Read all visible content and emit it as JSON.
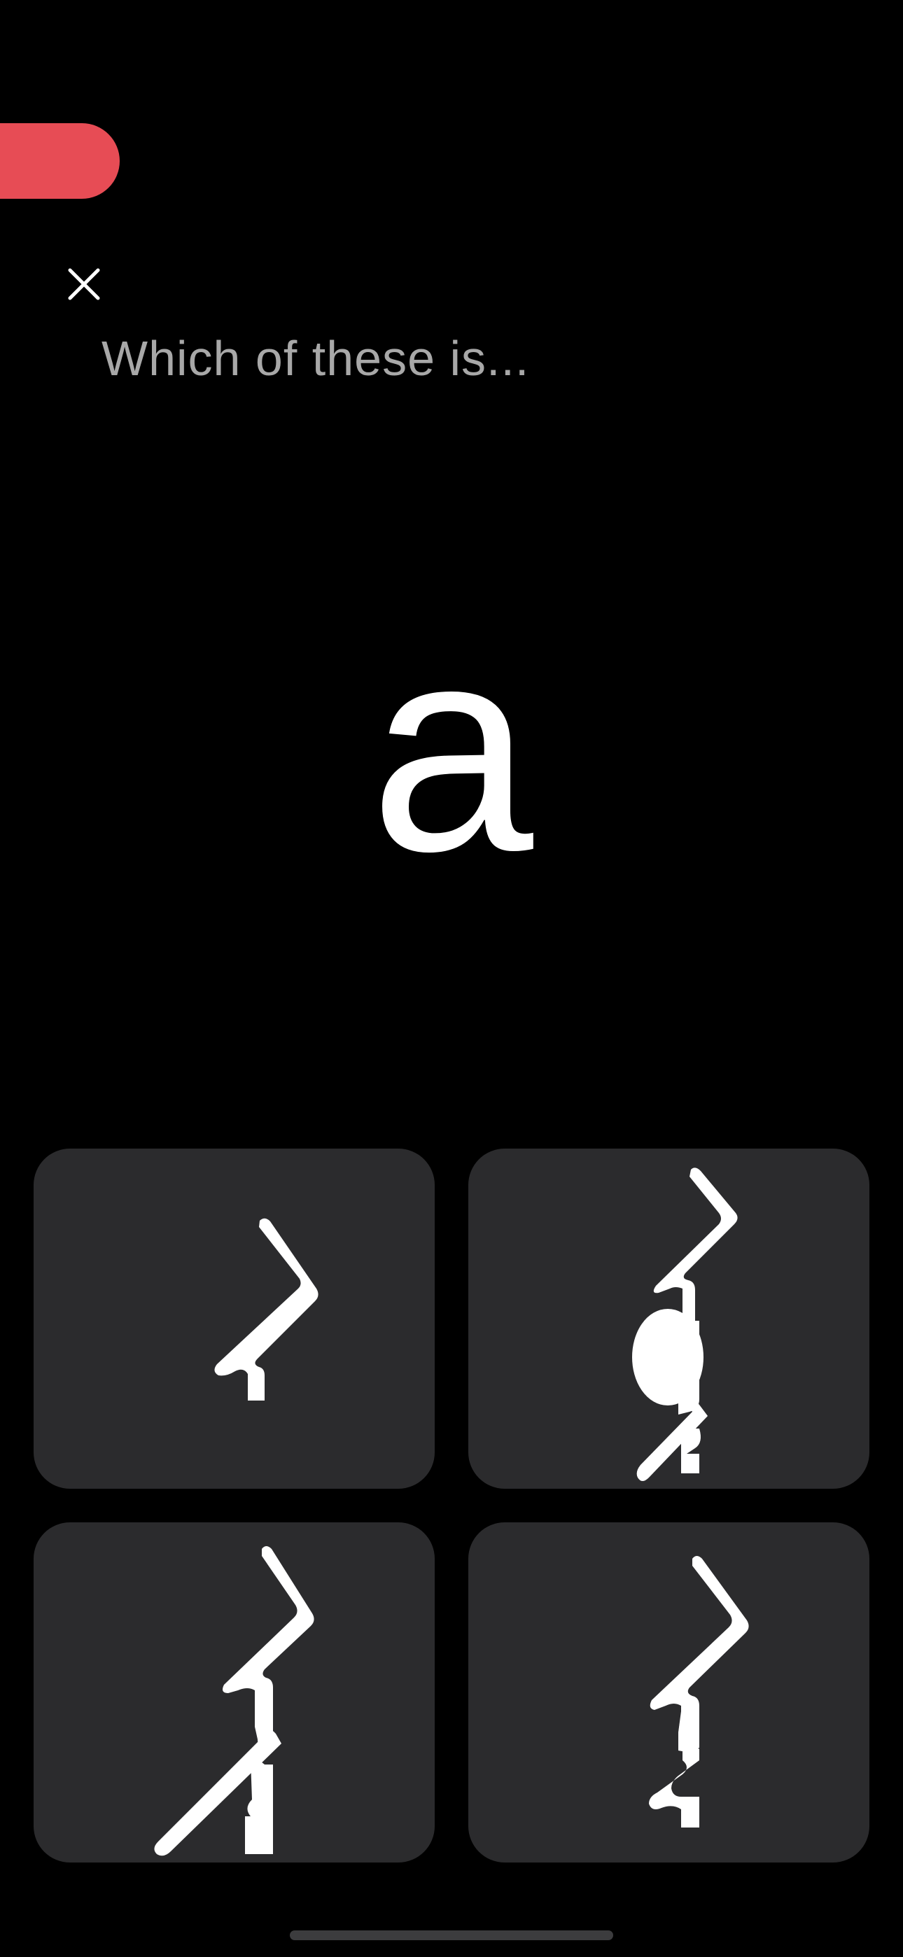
{
  "header": {
    "progress_color": "#e74c55",
    "close_icon": "close-icon"
  },
  "question": {
    "prompt": "Which of these is...",
    "target": "a"
  },
  "options": [
    {
      "glyph": "mongolian-script-glyph-1-icon"
    },
    {
      "glyph": "mongolian-script-glyph-2-icon"
    },
    {
      "glyph": "mongolian-script-glyph-3-icon"
    },
    {
      "glyph": "mongolian-script-glyph-4-icon"
    }
  ]
}
